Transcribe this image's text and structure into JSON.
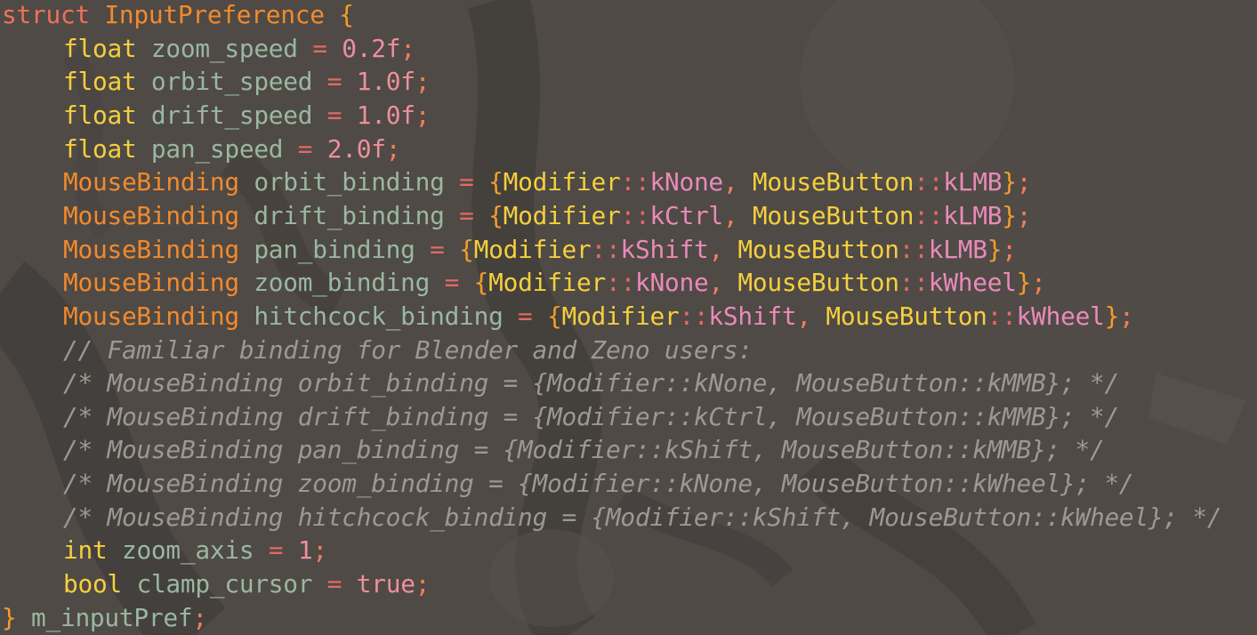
{
  "colors": {
    "background": "#4f4a46",
    "keyword_struct": "#f0715a",
    "type_keyword": "#f5cf3e",
    "identifier": "#9ab79f",
    "operator": "#e36a64",
    "number": "#ee8f9c",
    "punctuation": "#f07e58",
    "custom_type": "#f28a2d",
    "brace": "#f39d2b",
    "enum_scope": "#f5cf3e",
    "enum_value": "#ea8ab9",
    "comment": "#9e9892",
    "bool_literal": "#ee8f9c"
  },
  "editor": {
    "lines": [
      {
        "indent": 0,
        "tokens": [
          {
            "t": "struct",
            "c": "keyword_struct"
          },
          {
            "t": " ",
            "c": "identifier"
          },
          {
            "t": "InputPreference",
            "c": "custom_type"
          },
          {
            "t": " ",
            "c": "identifier"
          },
          {
            "t": "{",
            "c": "brace"
          }
        ]
      },
      {
        "indent": 1,
        "tokens": [
          {
            "t": "float",
            "c": "type_keyword"
          },
          {
            "t": " zoom_speed ",
            "c": "identifier"
          },
          {
            "t": "=",
            "c": "operator"
          },
          {
            "t": " ",
            "c": "identifier"
          },
          {
            "t": "0.2f",
            "c": "number"
          },
          {
            "t": ";",
            "c": "punctuation"
          }
        ]
      },
      {
        "indent": 1,
        "tokens": [
          {
            "t": "float",
            "c": "type_keyword"
          },
          {
            "t": " orbit_speed ",
            "c": "identifier"
          },
          {
            "t": "=",
            "c": "operator"
          },
          {
            "t": " ",
            "c": "identifier"
          },
          {
            "t": "1.0f",
            "c": "number"
          },
          {
            "t": ";",
            "c": "punctuation"
          }
        ]
      },
      {
        "indent": 1,
        "tokens": [
          {
            "t": "float",
            "c": "type_keyword"
          },
          {
            "t": " drift_speed ",
            "c": "identifier"
          },
          {
            "t": "=",
            "c": "operator"
          },
          {
            "t": " ",
            "c": "identifier"
          },
          {
            "t": "1.0f",
            "c": "number"
          },
          {
            "t": ";",
            "c": "punctuation"
          }
        ]
      },
      {
        "indent": 1,
        "tokens": [
          {
            "t": "float",
            "c": "type_keyword"
          },
          {
            "t": " pan_speed ",
            "c": "identifier"
          },
          {
            "t": "=",
            "c": "operator"
          },
          {
            "t": " ",
            "c": "identifier"
          },
          {
            "t": "2.0f",
            "c": "number"
          },
          {
            "t": ";",
            "c": "punctuation"
          }
        ]
      },
      {
        "indent": 1,
        "tokens": [
          {
            "t": "MouseBinding",
            "c": "custom_type"
          },
          {
            "t": " orbit_binding ",
            "c": "identifier"
          },
          {
            "t": "=",
            "c": "operator"
          },
          {
            "t": " ",
            "c": "identifier"
          },
          {
            "t": "{",
            "c": "brace"
          },
          {
            "t": "Modifier",
            "c": "enum_scope"
          },
          {
            "t": "::",
            "c": "operator"
          },
          {
            "t": "kNone",
            "c": "enum_value"
          },
          {
            "t": ", ",
            "c": "punctuation"
          },
          {
            "t": "MouseButton",
            "c": "enum_scope"
          },
          {
            "t": "::",
            "c": "operator"
          },
          {
            "t": "kLMB",
            "c": "enum_value"
          },
          {
            "t": "}",
            "c": "brace"
          },
          {
            "t": ";",
            "c": "punctuation"
          }
        ]
      },
      {
        "indent": 1,
        "tokens": [
          {
            "t": "MouseBinding",
            "c": "custom_type"
          },
          {
            "t": " drift_binding ",
            "c": "identifier"
          },
          {
            "t": "=",
            "c": "operator"
          },
          {
            "t": " ",
            "c": "identifier"
          },
          {
            "t": "{",
            "c": "brace"
          },
          {
            "t": "Modifier",
            "c": "enum_scope"
          },
          {
            "t": "::",
            "c": "operator"
          },
          {
            "t": "kCtrl",
            "c": "enum_value"
          },
          {
            "t": ", ",
            "c": "punctuation"
          },
          {
            "t": "MouseButton",
            "c": "enum_scope"
          },
          {
            "t": "::",
            "c": "operator"
          },
          {
            "t": "kLMB",
            "c": "enum_value"
          },
          {
            "t": "}",
            "c": "brace"
          },
          {
            "t": ";",
            "c": "punctuation"
          }
        ]
      },
      {
        "indent": 1,
        "tokens": [
          {
            "t": "MouseBinding",
            "c": "custom_type"
          },
          {
            "t": " pan_binding ",
            "c": "identifier"
          },
          {
            "t": "=",
            "c": "operator"
          },
          {
            "t": " ",
            "c": "identifier"
          },
          {
            "t": "{",
            "c": "brace"
          },
          {
            "t": "Modifier",
            "c": "enum_scope"
          },
          {
            "t": "::",
            "c": "operator"
          },
          {
            "t": "kShift",
            "c": "enum_value"
          },
          {
            "t": ", ",
            "c": "punctuation"
          },
          {
            "t": "MouseButton",
            "c": "enum_scope"
          },
          {
            "t": "::",
            "c": "operator"
          },
          {
            "t": "kLMB",
            "c": "enum_value"
          },
          {
            "t": "}",
            "c": "brace"
          },
          {
            "t": ";",
            "c": "punctuation"
          }
        ]
      },
      {
        "indent": 1,
        "tokens": [
          {
            "t": "MouseBinding",
            "c": "custom_type"
          },
          {
            "t": " zoom_binding ",
            "c": "identifier"
          },
          {
            "t": "=",
            "c": "operator"
          },
          {
            "t": " ",
            "c": "identifier"
          },
          {
            "t": "{",
            "c": "brace"
          },
          {
            "t": "Modifier",
            "c": "enum_scope"
          },
          {
            "t": "::",
            "c": "operator"
          },
          {
            "t": "kNone",
            "c": "enum_value"
          },
          {
            "t": ", ",
            "c": "punctuation"
          },
          {
            "t": "MouseButton",
            "c": "enum_scope"
          },
          {
            "t": "::",
            "c": "operator"
          },
          {
            "t": "kWheel",
            "c": "enum_value"
          },
          {
            "t": "}",
            "c": "brace"
          },
          {
            "t": ";",
            "c": "punctuation"
          }
        ]
      },
      {
        "indent": 1,
        "tokens": [
          {
            "t": "MouseBinding",
            "c": "custom_type"
          },
          {
            "t": " hitchcock_binding ",
            "c": "identifier"
          },
          {
            "t": "=",
            "c": "operator"
          },
          {
            "t": " ",
            "c": "identifier"
          },
          {
            "t": "{",
            "c": "brace"
          },
          {
            "t": "Modifier",
            "c": "enum_scope"
          },
          {
            "t": "::",
            "c": "operator"
          },
          {
            "t": "kShift",
            "c": "enum_value"
          },
          {
            "t": ", ",
            "c": "punctuation"
          },
          {
            "t": "MouseButton",
            "c": "enum_scope"
          },
          {
            "t": "::",
            "c": "operator"
          },
          {
            "t": "kWheel",
            "c": "enum_value"
          },
          {
            "t": "}",
            "c": "brace"
          },
          {
            "t": ";",
            "c": "punctuation"
          }
        ]
      },
      {
        "indent": 1,
        "comment": true,
        "tokens": [
          {
            "t": "// Familiar binding for Blender and Zeno users:",
            "c": "comment"
          }
        ]
      },
      {
        "indent": 1,
        "comment": true,
        "tokens": [
          {
            "t": "/* MouseBinding orbit_binding = {Modifier::kNone, MouseButton::kMMB}; */",
            "c": "comment"
          }
        ]
      },
      {
        "indent": 1,
        "comment": true,
        "tokens": [
          {
            "t": "/* MouseBinding drift_binding = {Modifier::kCtrl, MouseButton::kMMB}; */",
            "c": "comment"
          }
        ]
      },
      {
        "indent": 1,
        "comment": true,
        "tokens": [
          {
            "t": "/* MouseBinding pan_binding = {Modifier::kShift, MouseButton::kMMB}; */",
            "c": "comment"
          }
        ]
      },
      {
        "indent": 1,
        "comment": true,
        "tokens": [
          {
            "t": "/* MouseBinding zoom_binding = {Modifier::kNone, MouseButton::kWheel}; */",
            "c": "comment"
          }
        ]
      },
      {
        "indent": 1,
        "comment": true,
        "tokens": [
          {
            "t": "/* MouseBinding hitchcock_binding = {Modifier::kShift, MouseButton::kWheel}; */",
            "c": "comment"
          }
        ]
      },
      {
        "indent": 1,
        "tokens": [
          {
            "t": "int",
            "c": "type_keyword"
          },
          {
            "t": " zoom_axis ",
            "c": "identifier"
          },
          {
            "t": "=",
            "c": "operator"
          },
          {
            "t": " ",
            "c": "identifier"
          },
          {
            "t": "1",
            "c": "number"
          },
          {
            "t": ";",
            "c": "punctuation"
          }
        ]
      },
      {
        "indent": 1,
        "tokens": [
          {
            "t": "bool",
            "c": "type_keyword"
          },
          {
            "t": " clamp_cursor ",
            "c": "identifier"
          },
          {
            "t": "=",
            "c": "operator"
          },
          {
            "t": " ",
            "c": "identifier"
          },
          {
            "t": "true",
            "c": "bool_literal"
          },
          {
            "t": ";",
            "c": "punctuation"
          }
        ]
      },
      {
        "indent": 0,
        "tokens": [
          {
            "t": "}",
            "c": "brace"
          },
          {
            "t": " m_inputPref",
            "c": "identifier"
          },
          {
            "t": ";",
            "c": "punctuation"
          }
        ]
      }
    ]
  }
}
